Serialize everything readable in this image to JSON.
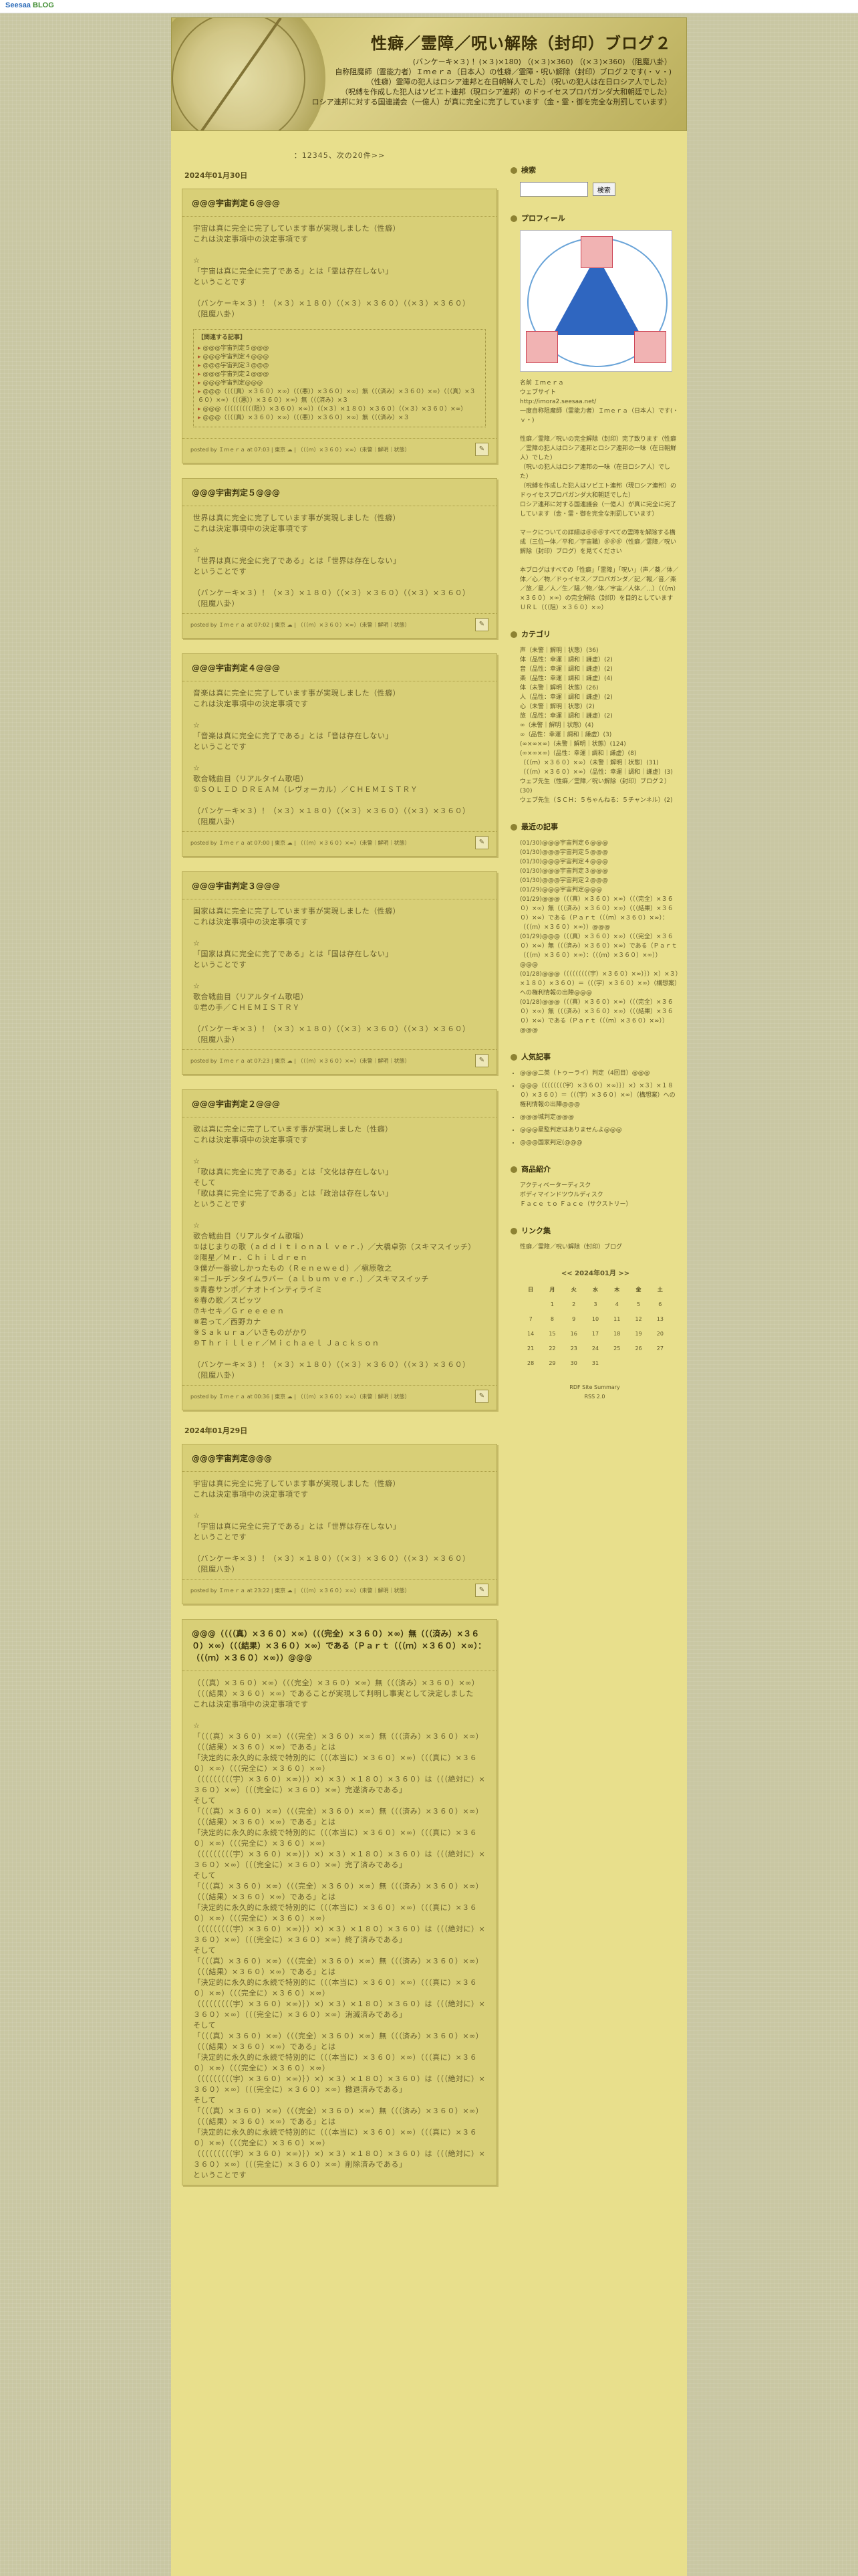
{
  "topbar": {
    "brand1": "Seesaa",
    "brand2": "BLOG"
  },
  "header": {
    "title": "性癖／霊障／呪い解除（封印）ブログ２",
    "desc": "(バンケーキ×３) ！(×３)×180) （(×３)×360) （(×３)×360) （阻魔八卦）\n自称阻魔師（霊能力者）Ｉｍｅｒａ（日本人）の性癖／霊障・呪い解除（封印）ブログ２です(・ｖ・)\n（性癖）霊障の犯人はロシア連邦と在日朝鮮人でした）（呪いの犯人は在日ロシア人でした）\n（呪縛を作成した犯人はソビエト連邦（現ロシア連邦）のドゥイセスプロパガンダ大和朝廷でした）\nロシア連邦に対する国連議会（一億人）が真に完全に完了しています（金・霊・御を完全な刑罰しています）"
  },
  "content": {
    "topnote": "：12345、次の20件>>",
    "date1": "2024年01月30日",
    "date2": "2024年01月29日",
    "entries": [
      {
        "title": "@@@宇宙判定６@@@",
        "body": "宇宙は真に完全に完了しています事が実現しました（性癖）\nこれは決定事項中の決定事項です\n\n☆\n「宇宙は真に完全に完了である」とは「霊は存在しない」\nということです\n\n（バンケーキ×３）！（×３）×１８０）（（×３）×３６０）（（×３）×３６０）\n（阻魔八卦）",
        "related_title": "【関連する記事】",
        "related": [
          "@@@宇宙判定５@@@",
          "@@@宇宙判定４@@@",
          "@@@宇宙判定３@@@",
          "@@@宇宙判定２@@@",
          "@@@宇宙判定@@@",
          "@@@（（（（真）×３６０）×∞）（（（悪））×３６０）×∞）無（（（済み）×３６０）×∞）（（（真）×３６０）×∞）（（（悪））×３６０）×∞）無（（（済み）×３",
          "@@@（（（（（（（（（（阻））×３６０）×∞））（（×３）×１８０）×３６０）（（×３）×３６０）×∞）",
          "@@@（（（（真）×３６０）×∞）（（（悪））×３６０）×∞）無（（（済み）×３"
        ],
        "foot": "posted by Ｉｍｅｒａ at 07:03 | 東京 ☁ | （（（ｍ）×３６０）×∞）（未警｜解明｜状態）"
      },
      {
        "title": "@@@宇宙判定５@@@",
        "body": "世界は真に完全に完了しています事が実現しました（性癖）\nこれは決定事項中の決定事項です\n\n☆\n「世界は真に完全に完了である」とは「世界は存在しない」\nということです\n\n（バンケーキ×３）！（×３）×１８０）（（×３）×３６０）（（×３）×３６０）\n（阻魔八卦）",
        "foot": "posted by Ｉｍｅｒａ at 07:02 | 東京 ☁ | （（（ｍ）×３６０）×∞）（未警｜解明｜状態）"
      },
      {
        "title": "@@@宇宙判定４@@@",
        "body": "音楽は真に完全に完了しています事が実現しました（性癖）\nこれは決定事項中の決定事項です\n\n☆\n「音楽は真に完全に完了である」とは「音は存在しない」\nということです\n\n☆\n歌合戦曲目（リアルタイム歌唱）\n①ＳＯＬＩＤ ＤＲＥＡＭ（レヴォーカル）／ＣＨＥＭＩＳＴＲＹ\n\n（バンケーキ×３）！（×３）×１８０）（（×３）×３６０）（（×３）×３６０）\n（阻魔八卦）",
        "foot": "posted by Ｉｍｅｒａ at 07:00 | 東京 ☁ | （（（ｍ）×３６０）×∞）（未警｜解明｜状態）"
      },
      {
        "title": "@@@宇宙判定３@@@",
        "body": "国家は真に完全に完了しています事が実現しました（性癖）\nこれは決定事項中の決定事項です\n\n☆\n「国家は真に完全に完了である」とは「国は存在しない」\nということです\n\n☆\n歌合戦曲目（リアルタイム歌唱）\n①君の手／ＣＨＥＭＩＳＴＲＹ\n\n（バンケーキ×３）！（×３）×１８０）（（×３）×３６０）（（×３）×３６０）\n（阻魔八卦）",
        "foot": "posted by Ｉｍｅｒａ at 07:23 | 東京 ☁ | （（（ｍ）×３６０）×∞）（未警｜解明｜状態）"
      },
      {
        "title": "@@@宇宙判定２@@@",
        "body": "歌は真に完全に完了しています事が実現しました（性癖）\nこれは決定事項中の決定事項です\n\n☆\n「歌は真に完全に完了である」とは「文化は存在しない」\nそして\n「歌は真に完全に完了である」とは「政治は存在しない」\nということです\n\n☆\n歌合戦曲目（リアルタイム歌唱）\n①はじまりの歌（ａｄｄｉｔｉｏｎａｌ ｖｅｒ．）／大橋卓弥（スキマスイッチ）\n②陽星／Ｍｒ．Ｃｈｉｌｄｒｅｎ\n③僕が一番欲しかったもの（Ｒｅｎｅｗｅｄ）／槇原敬之\n④ゴールデンタイムラバー（ａｌｂｕｍ ｖｅｒ．）／スキマスイッチ\n⑤青春サンポ／ナオトインティライミ\n⑥春の歌／スピッツ\n⑦キセキ／Ｇｒｅｅｅｅｎ\n⑧君って／西野カナ\n⑨Ｓａｋｕｒａ／いきものがかり\n⑩Ｔｈｒｉｌｌｅｒ／Ｍｉｃｈａｅｌ Ｊａｃｋｓｏｎ\n\n（バンケーキ×３）！（×３）×１８０）（（×３）×３６０）（（×３）×３６０）\n（阻魔八卦）",
        "foot": "posted by Ｉｍｅｒａ at 00:36 | 東京 ☁ | （（（ｍ）×３６０）×∞）（未警｜解明｜状態）"
      },
      {
        "title": "@@@宇宙判定@@@",
        "body": "宇宙は真に完全に完了しています事が実現しました（性癖）\nこれは決定事項中の決定事項です\n\n☆\n「宇宙は真に完全に完了である」とは「世界は存在しない」\nということです\n\n（バンケーキ×３）！（×３）×１８０）（（×３）×３６０）（（×３）×３６０）\n（阻魔八卦）",
        "foot": "posted by Ｉｍｅｒａ at 23:22 | 東京 ☁ | （（（ｍ）×３６０）×∞）（未警｜解明｜状態）"
      },
      {
        "title": "@@@（（（（真）×３６０）×∞）（（（完全）×３６０）×∞）無（（（済み）×３６０）×∞）（（（結果）×３６０）×∞）である（Ｐａｒｔ（（（ｍ）×３６０）×∞）：（（（ｍ）×３６０）×∞））@@@",
        "body": "（（（真）×３６０）×∞）（（（完全）×３６０）×∞）無（（（済み）×３６０）×∞）（（（結果）×３６０）×∞）であることが実現して判明し事実として決定しました\nこれは決定事項中の決定事項です\n\n☆\n「（（（真）×３６０）×∞）（（（完全）×３６０）×∞）無（（（済み）×３６０）×∞）（（（結果）×３６０）×∞）である」とは\n「決定的に永久的に永続で特別的に（（（本当に）×３６０）×∞）（（（真に）×３６０）×∞）（（（完全に）×３６０）×∞）\n（（（（（（（（（宇）×３６０）×∞）｝）×）×３）×１８０）×３６０）は（（（絶対に）×３６０）×∞）（（（完全に）×３６０）×∞）完遂済みである」\nそして\n「（（（真）×３６０）×∞）（（（完全）×３６０）×∞）無（（（済み）×３６０）×∞）（（（結果）×３６０）×∞）である」とは\n「決定的に永久的に永続で特別的に（（（本当に）×３６０）×∞）（（（真に）×３６０）×∞）（（（完全に）×３６０）×∞）\n（（（（（（（（（宇）×３６０）×∞）｝）×）×３）×１８０）×３６０）は（（（絶対に）×３６０）×∞）（（（完全に）×３６０）×∞）完了済みである」\nそして\n「（（（真）×３６０）×∞）（（（完全）×３６０）×∞）無（（（済み）×３６０）×∞）（（（結果）×３６０）×∞）である」とは\n「決定的に永久的に永続で特別的に（（（本当に）×３６０）×∞）（（（真に）×３６０）×∞）（（（完全に）×３６０）×∞）\n（（（（（（（（（宇）×３６０）×∞）｝）×）×３）×１８０）×３６０）は（（（絶対に）×３６０）×∞）（（（完全に）×３６０）×∞）終了済みである」\nそして\n「（（（真）×３６０）×∞）（（（完全）×３６０）×∞）無（（（済み）×３６０）×∞）（（（結果）×３６０）×∞）である」とは\n「決定的に永久的に永続で特別的に（（（本当に）×３６０）×∞）（（（真に）×３６０）×∞）（（（完全に）×３６０）×∞）\n（（（（（（（（（宇）×３６０）×∞）｝）×）×３）×１８０）×３６０）は（（（絶対に）×３６０）×∞）（（（完全に）×３６０）×∞）消滅済みである」\nそして\n「（（（真）×３６０）×∞）（（（完全）×３６０）×∞）無（（（済み）×３６０）×∞）（（（結果）×３６０）×∞）である」とは\n「決定的に永久的に永続で特別的に（（（本当に）×３６０）×∞）（（（真に）×３６０）×∞）（（（完全に）×３６０）×∞）\n（（（（（（（（（宇）×３６０）×∞）｝）×）×３）×１８０）×３６０）は（（（絶対に）×３６０）×∞）（（（完全に）×３６０）×∞）撤退済みである」\nそして\n「（（（真）×３６０）×∞）（（（完全）×３６０）×∞）無（（（済み）×３６０）×∞）（（（結果）×３６０）×∞）である」とは\n「決定的に永久的に永続で特別的に（（（本当に）×３６０）×∞）（（（真に）×３６０）×∞）（（（完全に）×３６０）×∞）\n（（（（（（（（（宇）×３６０）×∞）｝）×）×３）×１８０）×３６０）は（（（絶対に）×３６０）×∞）（（（完全に）×３６０）×∞）削除済みである」\nということです"
      }
    ]
  },
  "sidebar": {
    "search": {
      "title": "検索",
      "button": "検索"
    },
    "profile": {
      "title": "プロフィール",
      "text": "名前 Ｉｍｅｒａ\nウェブサイト\nhttp://imora2.seesaa.net/\n一度自称阻魔師（霊能力者）Ｉｍｅｒａ（日本人）です(・ｖ・)\n\n性癖／霊障／呪いの完全解除（封印）完了致ります（性癖／霊障の犯人はロシア連邦とロシア連邦の一味（在日朝鮮人）でした）\n（呪いの犯人はロシア連邦の一味（在日ロシア人）でした）\n（呪縛を作成した犯人はソビエト連邦（現ロシア連邦）のドゥイセスプロパガンダ大和朝廷でした）\nロシア連邦に対する国連議会（一億人）が真に完全に完了しています（金・霊・御を完全な刑罰しています）\n\nマークについての詳細は＠＠＠すべての霊障を解除する構成（三位一体／平和／宇宙職）＠＠＠（性癖／霊障／呪い解除（封印）ブログ）を見てください\n\n本ブログはすべての「性癖」「霊障」「呪い」（声／薬／体／体／心／物／ドゥイセス／プロパガンダ／記／報／音／楽／旅／星／人／生／陽／物／体／宇宙／人体／…）（（（ｍ）×３６０）×∞）の完全解除（封印）を目的としています\nＵＲＬ（（（阻）×３６０）×∞）"
    },
    "category": {
      "title": "カテゴリ",
      "items": [
        "声（未警｜解明｜状態）(36)",
        "体（品性：幸運｜調和｜謙虚）(2)",
        "音（品性：幸運｜調和｜謙虚）(2)",
        "楽（品性：幸運｜調和｜謙虚）(4)",
        "体（未警｜解明｜状態）(26)",
        "人（品性：幸運｜調和｜謙虚）(2)",
        "心（未警｜解明｜状態）(2)",
        "旅（品性：幸運｜調和｜謙虚）(2)",
        "∞（未警｜解明｜状態）(4)",
        "∞（品性：幸運｜調和｜謙虚）(3)",
        "(∞×∞×∞)（未警｜解明｜状態）(124)",
        "(∞×∞×∞)（品性：幸運｜調和｜謙虚）(8)",
        "（（（ｍ）×３６０）×∞）（未警｜解明｜状態）(31)",
        "（（（ｍ）×３６０）×∞）（品性：幸運｜調和｜謙虚）(3)",
        "ウェブ先生（性癖／霊障／呪い解除（封印）ブログ２）(30)",
        "ウェブ先生（ＳＣＨ：５ちゃんねる：５チャンネル）(2)"
      ]
    },
    "recent": {
      "title": "最近の記事",
      "items": [
        "(01/30)@@@宇宙判定６@@@",
        "(01/30)@@@宇宙判定５@@@",
        "(01/30)@@@宇宙判定４@@@",
        "(01/30)@@@宇宙判定３@@@",
        "(01/30)@@@宇宙判定２@@@",
        "(01/29)@@@宇宙判定@@@",
        "(01/29)@@@（（（真）×３６０）×∞）（（（完全）×３６０）×∞）無（（（済み）×３６０）×∞）（（（結果）×３６０）×∞）である（Ｐａｒｔ（（（ｍ）×３６０）×∞）：（（（ｍ）×３６０）×∞））@@@",
        "(01/29)@@@（（（真）×３６０）×∞）（（（完全）×３６０）×∞）無（（（済み）×３６０）×∞）である（Ｐａｒｔ（（（ｍ）×３６０）×∞）：（（（ｍ）×３６０）×∞））@@@",
        "(01/28)@@@（（（（（（（（（宇）×３６０）×∞）｝）×）×３）×１８０）×３６０）＝（（（宇）×３６０）×∞）（構想案）への権利情報の出陣@@@",
        "(01/28)@@@（（（真）×３６０）×∞）（（（完全）×３６０）×∞）無（（（済み）×３６０）×∞）（（（結果）×３６０）×∞）である（Ｐａｒｔ（（（ｍ）×３６０）×∞））@@@"
      ]
    },
    "popular": {
      "title": "人気記事",
      "items": [
        "@@@二英（トゥーライ）判定（4回目）@@@",
        "@@@（（（（（（（（宇）×３６０）×∞）｝）×）×３）×１８０）×３６０）＝（（（宇）×３６０）×∞）（構想案）への権利情報の出陣@@@",
        "@@@城判定@@@",
        "@@@星監判定はありませんよ@@@",
        "@@@国家判定(@@@"
      ]
    },
    "product": {
      "title": "商品紹介",
      "items": [
        "アクティベーターディスク",
        "ボディマインドツウルディスク",
        "Ｆａｃｅ ｔｏ Ｆａｃｅ（サクストリー）"
      ]
    },
    "links": {
      "title": "リンク集",
      "items": [
        "性癖／霊障／呪い解除（封印）ブログ"
      ]
    },
    "calendar": {
      "caption": "<< 2024年01月 >>",
      "days": [
        "日",
        "月",
        "火",
        "水",
        "木",
        "金",
        "土"
      ],
      "weeks": [
        [
          "",
          "1",
          "2",
          "3",
          "4",
          "5",
          "6"
        ],
        [
          "7",
          "8",
          "9",
          "10",
          "11",
          "12",
          "13"
        ],
        [
          "14",
          "15",
          "16",
          "17",
          "18",
          "19",
          "20"
        ],
        [
          "21",
          "22",
          "23",
          "24",
          "25",
          "26",
          "27"
        ],
        [
          "28",
          "29",
          "30",
          "31",
          "",
          "",
          ""
        ]
      ]
    },
    "rss": "RDF Site Summary\nRSS 2.0"
  }
}
